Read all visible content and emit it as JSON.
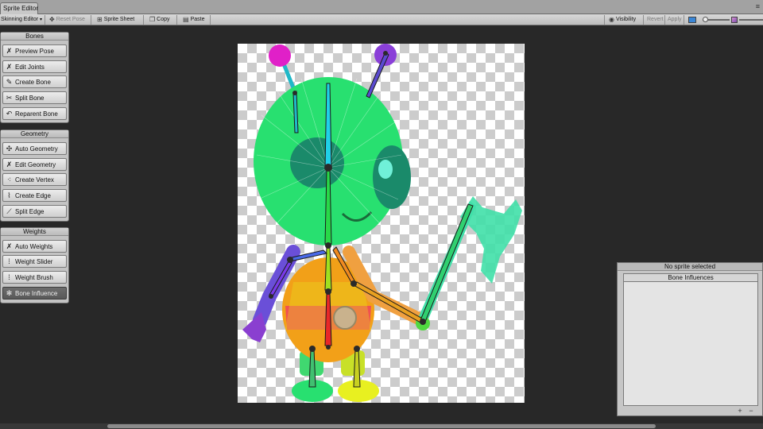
{
  "window": {
    "tab_title": "Sprite Editor",
    "menu_icon": "menu-icon"
  },
  "toolbar": {
    "mode": "Skinning Editor",
    "reset_pose": "Reset Pose",
    "sprite_sheet": "Sprite Sheet",
    "copy": "Copy",
    "paste": "Paste",
    "visibility": "Visibility",
    "revert": "Revert",
    "apply": "Apply",
    "swatch_color": "#3a86d6"
  },
  "panels": {
    "bones": {
      "title": "Bones",
      "items": [
        {
          "label": "Preview Pose",
          "icon": "preview-pose-icon"
        },
        {
          "label": "Edit Joints",
          "icon": "edit-joints-icon"
        },
        {
          "label": "Create Bone",
          "icon": "create-bone-icon"
        },
        {
          "label": "Split Bone",
          "icon": "split-bone-icon"
        },
        {
          "label": "Reparent Bone",
          "icon": "reparent-bone-icon"
        }
      ]
    },
    "geometry": {
      "title": "Geometry",
      "items": [
        {
          "label": "Auto Geometry",
          "icon": "auto-geometry-icon"
        },
        {
          "label": "Edit Geometry",
          "icon": "edit-geometry-icon"
        },
        {
          "label": "Create Vertex",
          "icon": "create-vertex-icon"
        },
        {
          "label": "Create Edge",
          "icon": "create-edge-icon"
        },
        {
          "label": "Split Edge",
          "icon": "split-edge-icon"
        }
      ]
    },
    "weights": {
      "title": "Weights",
      "items": [
        {
          "label": "Auto Weights",
          "icon": "auto-weights-icon"
        },
        {
          "label": "Weight Slider",
          "icon": "weight-slider-icon"
        },
        {
          "label": "Weight Brush",
          "icon": "weight-brush-icon"
        },
        {
          "label": "Bone Influence",
          "icon": "bone-influence-icon",
          "active": true
        }
      ]
    }
  },
  "influence": {
    "status": "No sprite selected",
    "header": "Bone Influences",
    "add_label": "+",
    "remove_label": "−"
  },
  "colors": {
    "head": "#28e070",
    "torso": "#f2a018",
    "belt": "#f04858",
    "left_arm": "#8a3fd0",
    "right_arm": "#f0a040",
    "axe": "#40e0a8",
    "antenna_left": "#e020c8",
    "antenna_right": "#8a3fd8",
    "left_foot": "#28e070",
    "right_foot": "#e8f020"
  }
}
